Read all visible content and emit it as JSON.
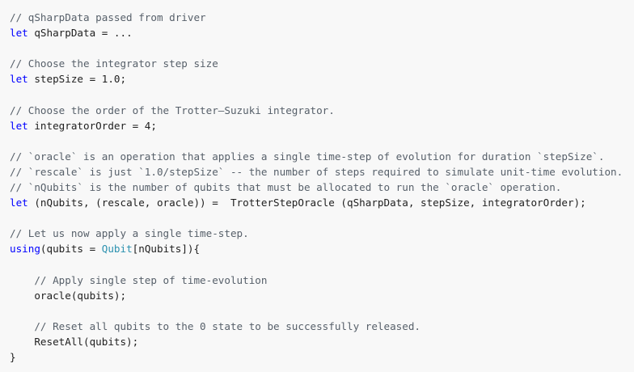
{
  "code": {
    "line01": "// qSharpData passed from driver",
    "line02_kw": "let",
    "line02_rest": " qSharpData = ...",
    "line04": "// Choose the integrator step size",
    "line05_kw": "let",
    "line05_rest": " stepSize = 1.0;",
    "line07": "// Choose the order of the Trotter—Suzuki integrator.",
    "line08_kw": "let",
    "line08_rest": " integratorOrder = 4;",
    "line10": "// `oracle` is an operation that applies a single time-step of evolution for duration `stepSize`.",
    "line11": "// `rescale` is just `1.0/stepSize` -- the number of steps required to simulate unit-time evolution.",
    "line12": "// `nQubits` is the number of qubits that must be allocated to run the `oracle` operation.",
    "line13_kw": "let",
    "line13_rest": " (nQubits, (rescale, oracle)) =  TrotterStepOracle (qSharpData, stepSize, integratorOrder);",
    "line15": "// Let us now apply a single time-step.",
    "line16_kw": "using",
    "line16_a": "(qubits = ",
    "line16_type": "Qubit",
    "line16_b": "[nQubits]){",
    "line18": "    // Apply single step of time-evolution",
    "line19": "    oracle(qubits);",
    "line21": "    // Reset all qubits to the 0 state to be successfully released.",
    "line22": "    ResetAll(qubits);",
    "line23": "}"
  },
  "colors": {
    "background": "#f8f8f8",
    "comment": "#57606a",
    "keyword": "#0000ff",
    "type": "#2b91af",
    "text": "#1e1e1e"
  }
}
